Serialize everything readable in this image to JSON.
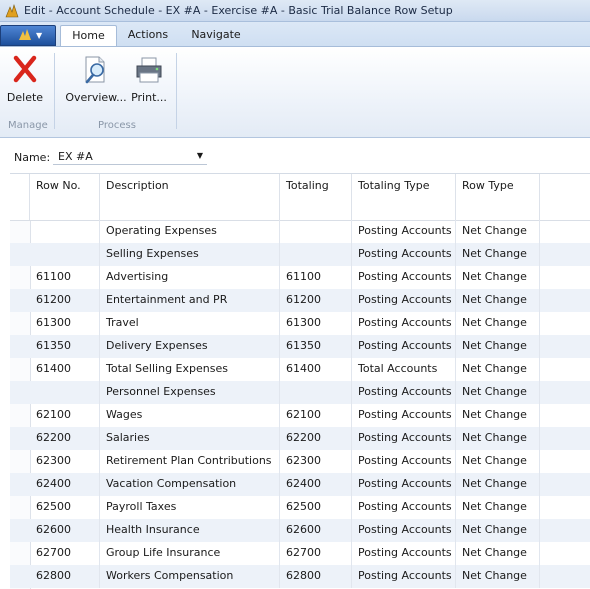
{
  "window": {
    "title": "Edit - Account Schedule - EX #A - Exercise #A - Basic Trial Balance Row Setup"
  },
  "ribbon": {
    "tabs": [
      "Home",
      "Actions",
      "Navigate"
    ],
    "buttons": {
      "delete": "Delete",
      "overview": "Overview...",
      "print": "Print..."
    },
    "groups": {
      "manage": "Manage",
      "process": "Process"
    }
  },
  "name_filter": {
    "label": "Name:",
    "value": "EX #A"
  },
  "grid": {
    "columns": [
      "Row No.",
      "Description",
      "Totaling",
      "Totaling Type",
      "Row Type"
    ],
    "rows": [
      {
        "row_no": "",
        "description": "Operating Expenses",
        "totaling": "",
        "totaling_type": "Posting Accounts",
        "row_type": "Net Change"
      },
      {
        "row_no": "",
        "description": "Selling Expenses",
        "totaling": "",
        "totaling_type": "Posting Accounts",
        "row_type": "Net Change"
      },
      {
        "row_no": "61100",
        "description": "Advertising",
        "totaling": "61100",
        "totaling_type": "Posting Accounts",
        "row_type": "Net Change"
      },
      {
        "row_no": "61200",
        "description": "Entertainment and PR",
        "totaling": "61200",
        "totaling_type": "Posting Accounts",
        "row_type": "Net Change"
      },
      {
        "row_no": "61300",
        "description": "Travel",
        "totaling": "61300",
        "totaling_type": "Posting Accounts",
        "row_type": "Net Change"
      },
      {
        "row_no": "61350",
        "description": "Delivery Expenses",
        "totaling": "61350",
        "totaling_type": "Posting Accounts",
        "row_type": "Net Change"
      },
      {
        "row_no": "61400",
        "description": "Total Selling Expenses",
        "totaling": "61400",
        "totaling_type": "Total Accounts",
        "row_type": "Net Change"
      },
      {
        "row_no": "",
        "description": "Personnel Expenses",
        "totaling": "",
        "totaling_type": "Posting Accounts",
        "row_type": "Net Change"
      },
      {
        "row_no": "62100",
        "description": "Wages",
        "totaling": "62100",
        "totaling_type": "Posting Accounts",
        "row_type": "Net Change"
      },
      {
        "row_no": "62200",
        "description": "Salaries",
        "totaling": "62200",
        "totaling_type": "Posting Accounts",
        "row_type": "Net Change"
      },
      {
        "row_no": "62300",
        "description": "Retirement Plan Contributions",
        "totaling": "62300",
        "totaling_type": "Posting Accounts",
        "row_type": "Net Change"
      },
      {
        "row_no": "62400",
        "description": "Vacation Compensation",
        "totaling": "62400",
        "totaling_type": "Posting Accounts",
        "row_type": "Net Change"
      },
      {
        "row_no": "62500",
        "description": "Payroll Taxes",
        "totaling": "62500",
        "totaling_type": "Posting Accounts",
        "row_type": "Net Change"
      },
      {
        "row_no": "62600",
        "description": "Health Insurance",
        "totaling": "62600",
        "totaling_type": "Posting Accounts",
        "row_type": "Net Change"
      },
      {
        "row_no": "62700",
        "description": "Group Life Insurance",
        "totaling": "62700",
        "totaling_type": "Posting Accounts",
        "row_type": "Net Change"
      },
      {
        "row_no": "62800",
        "description": "Workers Compensation",
        "totaling": "62800",
        "totaling_type": "Posting Accounts",
        "row_type": "Net Change"
      }
    ]
  },
  "colors": {
    "ribbon_accent": "#1d4f9b",
    "delete_red": "#d9261c",
    "row_alt": "#edf2f9"
  }
}
